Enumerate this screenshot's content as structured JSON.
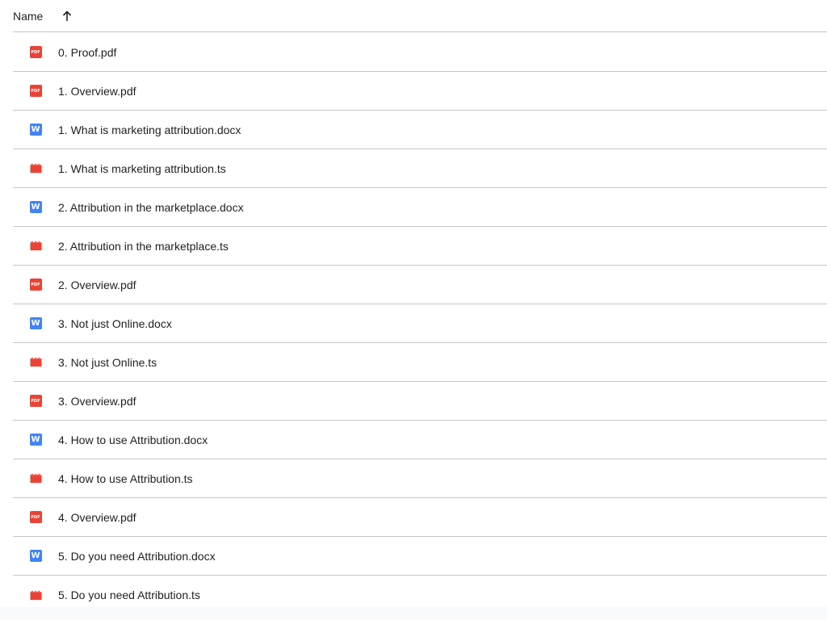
{
  "header": {
    "name_label": "Name",
    "sort_direction": "ascending"
  },
  "colors": {
    "pdf": "#ea4335",
    "docx": "#4285f4",
    "video": "#ea4335",
    "divider": "#c7c7c7"
  },
  "icon_text": {
    "pdf": "PDF",
    "docx": "W"
  },
  "files": [
    {
      "name": "0. Proof.pdf",
      "type": "pdf"
    },
    {
      "name": "1. Overview.pdf",
      "type": "pdf"
    },
    {
      "name": "1. What is marketing attribution.docx",
      "type": "docx"
    },
    {
      "name": "1. What is marketing attribution.ts",
      "type": "video"
    },
    {
      "name": "2. Attribution in the marketplace.docx",
      "type": "docx"
    },
    {
      "name": "2. Attribution in the marketplace.ts",
      "type": "video"
    },
    {
      "name": "2. Overview.pdf",
      "type": "pdf"
    },
    {
      "name": "3. Not just Online.docx",
      "type": "docx"
    },
    {
      "name": "3. Not just Online.ts",
      "type": "video"
    },
    {
      "name": "3. Overview.pdf",
      "type": "pdf"
    },
    {
      "name": "4. How to use Attribution.docx",
      "type": "docx"
    },
    {
      "name": "4. How to use Attribution.ts",
      "type": "video"
    },
    {
      "name": "4. Overview.pdf",
      "type": "pdf"
    },
    {
      "name": "5. Do you need Attribution.docx",
      "type": "docx"
    },
    {
      "name": "5. Do you need Attribution.ts",
      "type": "video"
    }
  ]
}
